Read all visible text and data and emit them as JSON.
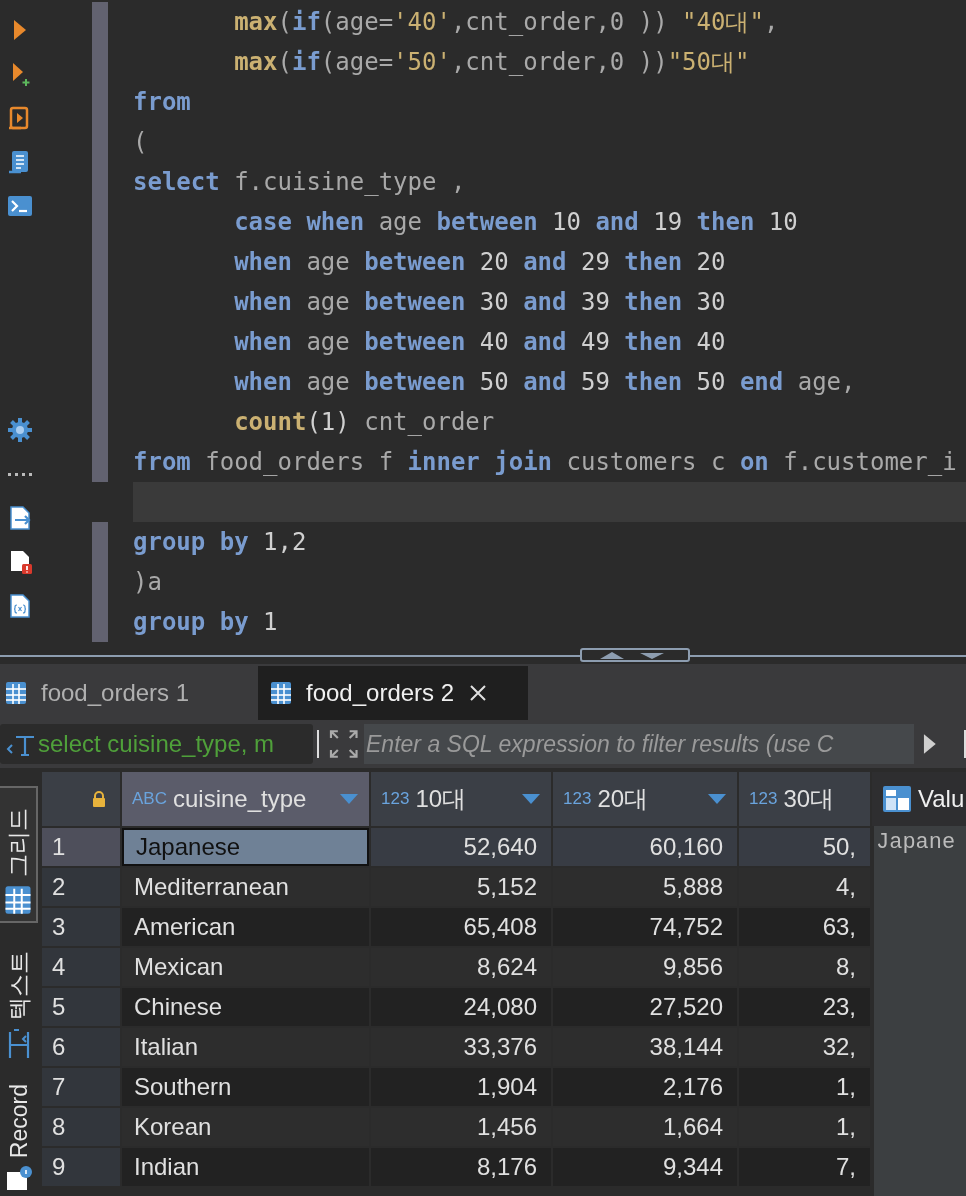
{
  "editor": {
    "lines": [
      {
        "indented": true,
        "marked": true,
        "current": false,
        "tokens": [
          {
            "kind": "fn",
            "text": "max"
          },
          {
            "kind": "plain",
            "text": "("
          },
          {
            "kind": "kw",
            "text": "if"
          },
          {
            "kind": "plain",
            "text": "(age="
          },
          {
            "kind": "str",
            "text": "'40'"
          },
          {
            "kind": "plain",
            "text": ",cnt_order,0 )) "
          },
          {
            "kind": "str",
            "text": "\"40대\""
          },
          {
            "kind": "plain",
            "text": ","
          }
        ]
      },
      {
        "indented": true,
        "marked": true,
        "current": false,
        "tokens": [
          {
            "kind": "fn",
            "text": "max"
          },
          {
            "kind": "plain",
            "text": "("
          },
          {
            "kind": "kw",
            "text": "if"
          },
          {
            "kind": "plain",
            "text": "(age="
          },
          {
            "kind": "str",
            "text": "'50'"
          },
          {
            "kind": "plain",
            "text": ",cnt_order,0 ))"
          },
          {
            "kind": "str",
            "text": "\"50대\""
          }
        ]
      },
      {
        "indented": false,
        "marked": true,
        "current": false,
        "tokens": [
          {
            "kind": "kw",
            "text": "from"
          }
        ]
      },
      {
        "indented": false,
        "marked": true,
        "current": false,
        "tokens": [
          {
            "kind": "plain",
            "text": "("
          }
        ]
      },
      {
        "indented": false,
        "marked": true,
        "current": false,
        "tokens": [
          {
            "kind": "kw",
            "text": "select"
          },
          {
            "kind": "plain",
            "text": " f.cuisine_type ,"
          }
        ]
      },
      {
        "indented": true,
        "marked": true,
        "current": false,
        "tokens": [
          {
            "kind": "kw",
            "text": "case when"
          },
          {
            "kind": "plain",
            "text": " age "
          },
          {
            "kind": "kw",
            "text": "between"
          },
          {
            "kind": "num",
            "text": " 10 "
          },
          {
            "kind": "kw",
            "text": "and"
          },
          {
            "kind": "num",
            "text": " 19 "
          },
          {
            "kind": "kw",
            "text": "then"
          },
          {
            "kind": "num",
            "text": " 10"
          }
        ]
      },
      {
        "indented": true,
        "marked": true,
        "current": false,
        "tokens": [
          {
            "kind": "kw",
            "text": "when"
          },
          {
            "kind": "plain",
            "text": " age "
          },
          {
            "kind": "kw",
            "text": "between"
          },
          {
            "kind": "num",
            "text": " 20 "
          },
          {
            "kind": "kw",
            "text": "and"
          },
          {
            "kind": "num",
            "text": " 29 "
          },
          {
            "kind": "kw",
            "text": "then"
          },
          {
            "kind": "num",
            "text": " 20"
          }
        ]
      },
      {
        "indented": true,
        "marked": true,
        "current": false,
        "tokens": [
          {
            "kind": "kw",
            "text": "when"
          },
          {
            "kind": "plain",
            "text": " age "
          },
          {
            "kind": "kw",
            "text": "between"
          },
          {
            "kind": "num",
            "text": " 30 "
          },
          {
            "kind": "kw",
            "text": "and"
          },
          {
            "kind": "num",
            "text": " 39 "
          },
          {
            "kind": "kw",
            "text": "then"
          },
          {
            "kind": "num",
            "text": " 30"
          }
        ]
      },
      {
        "indented": true,
        "marked": true,
        "current": false,
        "tokens": [
          {
            "kind": "kw",
            "text": "when"
          },
          {
            "kind": "plain",
            "text": " age "
          },
          {
            "kind": "kw",
            "text": "between"
          },
          {
            "kind": "num",
            "text": " 40 "
          },
          {
            "kind": "kw",
            "text": "and"
          },
          {
            "kind": "num",
            "text": " 49 "
          },
          {
            "kind": "kw",
            "text": "then"
          },
          {
            "kind": "num",
            "text": " 40"
          }
        ]
      },
      {
        "indented": true,
        "marked": true,
        "current": false,
        "tokens": [
          {
            "kind": "kw",
            "text": "when"
          },
          {
            "kind": "plain",
            "text": " age "
          },
          {
            "kind": "kw",
            "text": "between"
          },
          {
            "kind": "num",
            "text": " 50 "
          },
          {
            "kind": "kw",
            "text": "and"
          },
          {
            "kind": "num",
            "text": " 59 "
          },
          {
            "kind": "kw",
            "text": "then"
          },
          {
            "kind": "num",
            "text": " 50 "
          },
          {
            "kind": "kw",
            "text": "end"
          },
          {
            "kind": "plain",
            "text": " age,"
          }
        ]
      },
      {
        "indented": true,
        "marked": true,
        "current": false,
        "tokens": [
          {
            "kind": "fn",
            "text": "count"
          },
          {
            "kind": "num",
            "text": "(1)"
          },
          {
            "kind": "plain",
            "text": " cnt_order"
          }
        ]
      },
      {
        "indented": false,
        "marked": true,
        "current": false,
        "tokens": [
          {
            "kind": "kw",
            "text": "from"
          },
          {
            "kind": "plain",
            "text": " food_orders f "
          },
          {
            "kind": "kw",
            "text": "inner join"
          },
          {
            "kind": "plain",
            "text": " customers c "
          },
          {
            "kind": "kw",
            "text": "on"
          },
          {
            "kind": "plain",
            "text": " f.customer_i"
          }
        ]
      },
      {
        "indented": false,
        "marked": false,
        "current": true
      },
      {
        "indented": false,
        "marked": true,
        "current": false,
        "tokens": [
          {
            "kind": "kw",
            "text": "group by"
          },
          {
            "kind": "num",
            "text": " 1,2"
          }
        ]
      },
      {
        "indented": false,
        "marked": true,
        "current": false,
        "tokens": [
          {
            "kind": "plain",
            "text": ")a"
          }
        ]
      },
      {
        "indented": false,
        "marked": true,
        "current": false,
        "tokens": [
          {
            "kind": "kw",
            "text": "group by"
          },
          {
            "kind": "num",
            "text": " 1"
          }
        ]
      }
    ]
  },
  "result_tabs": [
    {
      "label": "food_orders 1",
      "selected": false
    },
    {
      "label": "food_orders 2",
      "selected": true
    }
  ],
  "filter": {
    "query": "select cuisine_type, m",
    "placeholder": "Enter a SQL expression to filter results (use C"
  },
  "side_tabs": [
    {
      "label": "그리드",
      "selected": true
    },
    {
      "label": "텍스트",
      "selected": false
    },
    {
      "label": "Record",
      "selected": false
    }
  ],
  "grid": {
    "columns": [
      {
        "type_label": "ABC",
        "name": "cuisine_type",
        "selected": true,
        "filter_arrow": true
      },
      {
        "type_label": "123",
        "name": "10대",
        "selected": false,
        "filter_arrow": true
      },
      {
        "type_label": "123",
        "name": "20대",
        "selected": false,
        "filter_arrow": true
      },
      {
        "type_label": "123",
        "name": "30대",
        "selected": false,
        "filter_arrow": false
      }
    ],
    "rows": [
      {
        "number": "1",
        "selected": true,
        "cells": [
          "Japanese",
          "52,640",
          "60,160",
          "50,"
        ]
      },
      {
        "number": "2",
        "selected": false,
        "cells": [
          "Mediterranean",
          "5,152",
          "5,888",
          "4,"
        ]
      },
      {
        "number": "3",
        "selected": false,
        "cells": [
          "American",
          "65,408",
          "74,752",
          "63,"
        ]
      },
      {
        "number": "4",
        "selected": false,
        "cells": [
          "Mexican",
          "8,624",
          "9,856",
          "8,"
        ]
      },
      {
        "number": "5",
        "selected": false,
        "cells": [
          "Chinese",
          "24,080",
          "27,520",
          "23,"
        ]
      },
      {
        "number": "6",
        "selected": false,
        "cells": [
          "Italian",
          "33,376",
          "38,144",
          "32,"
        ]
      },
      {
        "number": "7",
        "selected": false,
        "cells": [
          "Southern",
          "1,904",
          "2,176",
          "1,"
        ]
      },
      {
        "number": "8",
        "selected": false,
        "cells": [
          "Korean",
          "1,456",
          "1,664",
          "1,"
        ]
      },
      {
        "number": "9",
        "selected": false,
        "cells": [
          "Indian",
          "8,176",
          "9,344",
          "7,"
        ]
      }
    ]
  },
  "value_panel": {
    "title": "Valu",
    "content": "Japane"
  }
}
